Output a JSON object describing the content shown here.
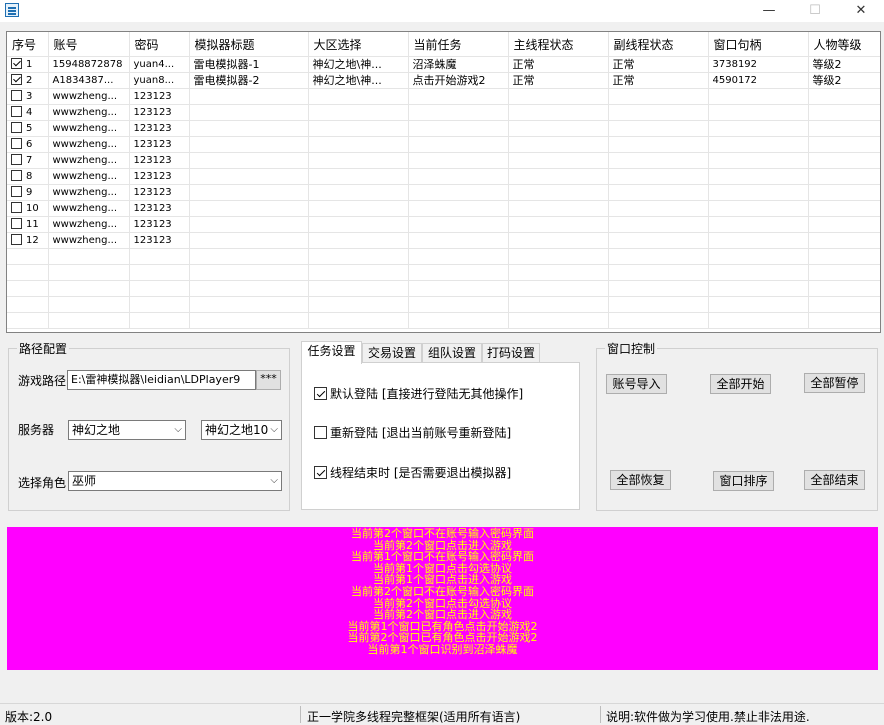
{
  "window": {
    "minimize": "—",
    "maximize": "☐",
    "close": "✕"
  },
  "grid": {
    "columns": [
      "序号",
      "账号",
      "密码",
      "模拟器标题",
      "大区选择",
      "当前任务",
      "主线程状态",
      "副线程状态",
      "窗口句柄",
      "人物等级"
    ],
    "rows": [
      {
        "checked": true,
        "cells": [
          "1",
          "15948872878",
          "yuan4...",
          "雷电模拟器-1",
          "神幻之地\\神...",
          "沼泽蛛魔",
          "正常",
          "正常",
          "3738192",
          "等级2"
        ]
      },
      {
        "checked": true,
        "cells": [
          "2",
          "A1834387...",
          "yuan8...",
          "雷电模拟器-2",
          "神幻之地\\神...",
          "点击开始游戏2",
          "正常",
          "正常",
          "4590172",
          "等级2"
        ]
      },
      {
        "checked": false,
        "cells": [
          "3",
          "wwwzheng...",
          "123123",
          "",
          "",
          "",
          "",
          "",
          "",
          ""
        ]
      },
      {
        "checked": false,
        "cells": [
          "4",
          "wwwzheng...",
          "123123",
          "",
          "",
          "",
          "",
          "",
          "",
          ""
        ]
      },
      {
        "checked": false,
        "cells": [
          "5",
          "wwwzheng...",
          "123123",
          "",
          "",
          "",
          "",
          "",
          "",
          ""
        ]
      },
      {
        "checked": false,
        "cells": [
          "6",
          "wwwzheng...",
          "123123",
          "",
          "",
          "",
          "",
          "",
          "",
          ""
        ]
      },
      {
        "checked": false,
        "cells": [
          "7",
          "wwwzheng...",
          "123123",
          "",
          "",
          "",
          "",
          "",
          "",
          ""
        ]
      },
      {
        "checked": false,
        "cells": [
          "8",
          "wwwzheng...",
          "123123",
          "",
          "",
          "",
          "",
          "",
          "",
          ""
        ]
      },
      {
        "checked": false,
        "cells": [
          "9",
          "wwwzheng...",
          "123123",
          "",
          "",
          "",
          "",
          "",
          "",
          ""
        ]
      },
      {
        "checked": false,
        "cells": [
          "10",
          "wwwzheng...",
          "123123",
          "",
          "",
          "",
          "",
          "",
          "",
          ""
        ]
      },
      {
        "checked": false,
        "cells": [
          "11",
          "wwwzheng...",
          "123123",
          "",
          "",
          "",
          "",
          "",
          "",
          ""
        ]
      },
      {
        "checked": false,
        "cells": [
          "12",
          "wwwzheng...",
          "123123",
          "",
          "",
          "",
          "",
          "",
          "",
          ""
        ]
      }
    ]
  },
  "path_config": {
    "title": "路径配置",
    "game_path_label": "游戏路径",
    "game_path_value": "E:\\雷神模拟器\\leidian\\LDPlayer9",
    "browse_label": "***",
    "server_label": "服务器",
    "server_value": "神幻之地",
    "server2_value": "神幻之地10",
    "role_label": "选择角色",
    "role_value": "巫师"
  },
  "tabs": [
    "任务设置",
    "交易设置",
    "组队设置",
    "打码设置"
  ],
  "task_settings": {
    "opt1": {
      "checked": true,
      "label": "默认登陆 [直接进行登陆无其他操作]"
    },
    "opt2": {
      "checked": false,
      "label": "重新登陆 [退出当前账号重新登陆]"
    },
    "opt3": {
      "checked": true,
      "label": "线程结束时 [是否需要退出模拟器]"
    }
  },
  "window_control": {
    "title": "窗口控制",
    "import": "账号导入",
    "start_all": "全部开始",
    "pause_all": "全部暂停",
    "resume_all": "全部恢复",
    "sort_windows": "窗口排序",
    "end_all": "全部结束"
  },
  "log": [
    "当前第2个窗口不在账号输入密码界面",
    "当前第2个窗口点击进入游戏",
    "当前第1个窗口不在账号输入密码界面",
    "当前第1个窗口点击勾选协议",
    "当前第1个窗口点击进入游戏",
    "当前第2个窗口不在账号输入密码界面",
    "当前第2个窗口点击勾选协议",
    "当前第2个窗口点击进入游戏",
    "当前第1个窗口已有角色点击开始游戏2",
    "当前第2个窗口已有角色点击开始游戏2",
    "当前第1个窗口识别到沼泽蛛魔"
  ],
  "status": {
    "version": "版本:2.0",
    "framework": "正一学院多线程完整框架(适用所有语言)",
    "note": "说明:软件做为学习使用.禁止非法用途."
  },
  "colors": {
    "log_bg": "#ff00ff",
    "log_text": "#ffff00"
  }
}
